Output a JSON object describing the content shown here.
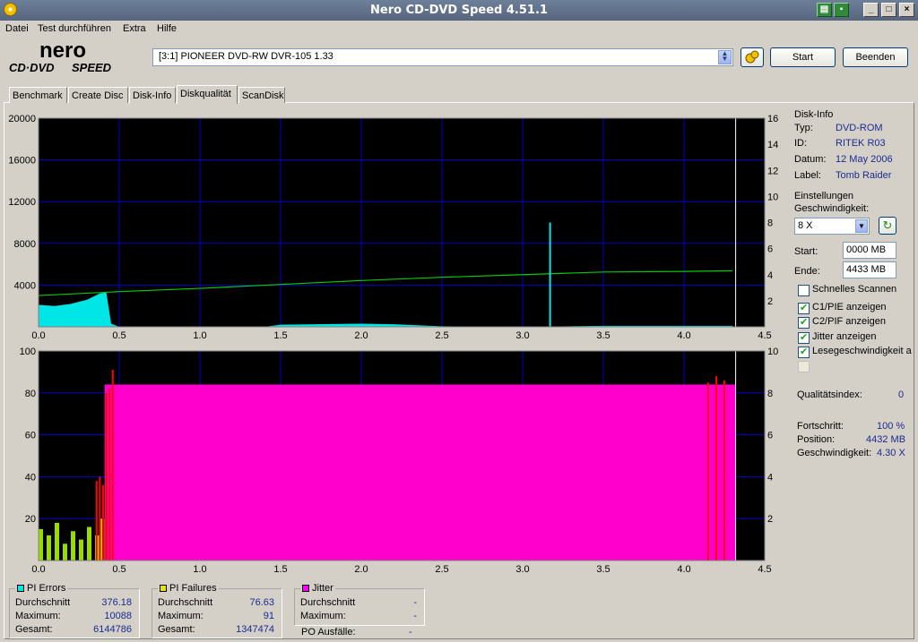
{
  "window": {
    "title": "Nero CD-DVD Speed 4.51.1"
  },
  "menu": [
    "Datei",
    "Test durchführen",
    "Extra",
    "Hilfe"
  ],
  "logo": {
    "line1": "nero",
    "line2": "CD·DVD",
    "line3": "SPEED"
  },
  "drive": {
    "selected": "[3:1]  PIONEER DVD-RW  DVR-105 1.33"
  },
  "buttons": {
    "start": "Start",
    "beenden": "Beenden"
  },
  "tabs": [
    "Benchmark",
    "Create Disc",
    "Disk-Info",
    "Diskqualität",
    "ScanDisk"
  ],
  "active_tab": 3,
  "disk_info": {
    "heading": "Disk-Info",
    "typ_label": "Typ:",
    "typ": "DVD-ROM",
    "id_label": "ID:",
    "id": "RITEK R03",
    "datum_label": "Datum:",
    "datum": "12 May 2006",
    "label_label": "Label:",
    "label": "Tomb Raider"
  },
  "settings": {
    "heading": "Einstellungen",
    "speed_label": "Geschwindigkeit:",
    "speed": "8 X",
    "start_label": "Start:",
    "start": "0000 MB",
    "ende_label": "Ende:",
    "ende": "4433 MB",
    "checkboxes": [
      {
        "label": "Schnelles Scannen",
        "checked": false
      },
      {
        "label": "C1/PIE anzeigen",
        "checked": true
      },
      {
        "label": "C2/PIF anzeigen",
        "checked": true
      },
      {
        "label": "Jitter anzeigen",
        "checked": true
      },
      {
        "label": "Lesegeschwindigkeit a",
        "checked": true
      },
      {
        "label": "",
        "checked": false
      }
    ]
  },
  "quality": {
    "label": "Qualitätsindex:",
    "value": "0"
  },
  "progress": {
    "fortschritt_label": "Fortschritt:",
    "fortschritt": "100 %",
    "position_label": "Position:",
    "position": "4432 MB",
    "speed_label": "Geschwindigkeit:",
    "speed": "4.30 X"
  },
  "stats": {
    "pi_errors": {
      "title": "PI Errors",
      "color": "#00e5e5",
      "avg_label": "Durchschnitt",
      "avg": "376.18",
      "max_label": "Maximum:",
      "max": "10088",
      "total_label": "Gesamt:",
      "total": "6144786"
    },
    "pi_failures": {
      "title": "PI Failures",
      "color": "#e5e500",
      "avg_label": "Durchschnitt",
      "avg": "76.63",
      "max_label": "Maximum:",
      "max": "91",
      "total_label": "Gesamt:",
      "total": "1347474"
    },
    "jitter": {
      "title": "Jitter",
      "color": "#ff00ff",
      "avg_label": "Durchschnitt",
      "avg": "-",
      "max_label": "Maximum:",
      "max": "-",
      "po_label": "PO Ausfälle:",
      "po": "-"
    }
  },
  "chart_data": [
    {
      "type": "area",
      "name": "pi-errors",
      "x_ticks": [
        "0.0",
        "0.5",
        "1.0",
        "1.5",
        "2.0",
        "2.5",
        "3.0",
        "3.5",
        "4.0",
        "4.5"
      ],
      "y_ticks_left": [
        "20000",
        "16000",
        "12000",
        "8000",
        "4000"
      ],
      "y_ticks_right": [
        "16",
        "14",
        "12",
        "10",
        "8",
        "6",
        "4",
        "2"
      ],
      "xlim": [
        0,
        4.5
      ],
      "ylim_left": [
        0,
        20000
      ],
      "ylim_right": [
        0,
        16
      ],
      "pi_errors": {
        "color": "#00e5e5",
        "x": [
          0.0,
          0.1,
          0.2,
          0.3,
          0.38,
          0.42,
          0.45,
          0.5,
          1.0,
          1.4,
          1.5,
          2.0,
          2.2,
          2.5,
          3.0,
          3.5,
          4.0,
          4.3
        ],
        "y": [
          2100,
          2000,
          2200,
          2600,
          3200,
          3300,
          300,
          0,
          0,
          0,
          200,
          300,
          250,
          50,
          0,
          100,
          100,
          100
        ]
      },
      "read_speed": {
        "color": "#00cc00",
        "x": [
          0.0,
          0.5,
          1.0,
          1.5,
          2.0,
          2.5,
          3.0,
          3.5,
          4.0,
          4.3
        ],
        "y": [
          2.4,
          2.7,
          2.95,
          3.25,
          3.55,
          3.8,
          4.0,
          4.2,
          4.25,
          4.3
        ]
      },
      "spike": {
        "x": 3.17,
        "y": 10000
      },
      "end_marker_x": 4.32
    },
    {
      "type": "bar",
      "name": "pi-failures",
      "x_ticks": [
        "0.0",
        "0.5",
        "1.0",
        "1.5",
        "2.0",
        "2.5",
        "3.0",
        "3.5",
        "4.0",
        "4.5"
      ],
      "y_ticks_left": [
        "100",
        "80",
        "60",
        "40",
        "20"
      ],
      "y_ticks_right": [
        "10",
        "8",
        "6",
        "4",
        "2"
      ],
      "xlim": [
        0,
        4.5
      ],
      "ylim_left": [
        0,
        100
      ],
      "ylim_right": [
        0,
        10
      ],
      "jitter_fill": {
        "color": "#ff00cc",
        "x_start": 0.41,
        "x_end": 4.32,
        "level": 84
      },
      "pi_failures": {
        "color": "#99dd00",
        "x": [
          0.0,
          0.05,
          0.1,
          0.15,
          0.2,
          0.25,
          0.3,
          0.35,
          0.38
        ],
        "y": [
          15,
          12,
          18,
          8,
          14,
          10,
          16,
          12,
          20
        ]
      },
      "red_spikes": {
        "color": "#ff0000",
        "x": [
          0.36,
          0.38,
          0.4,
          0.42,
          0.44,
          0.46,
          4.15,
          4.2,
          4.25
        ],
        "y": [
          38,
          40,
          36,
          80,
          82,
          91,
          85,
          88,
          86
        ]
      },
      "end_marker_x": 4.32
    }
  ]
}
